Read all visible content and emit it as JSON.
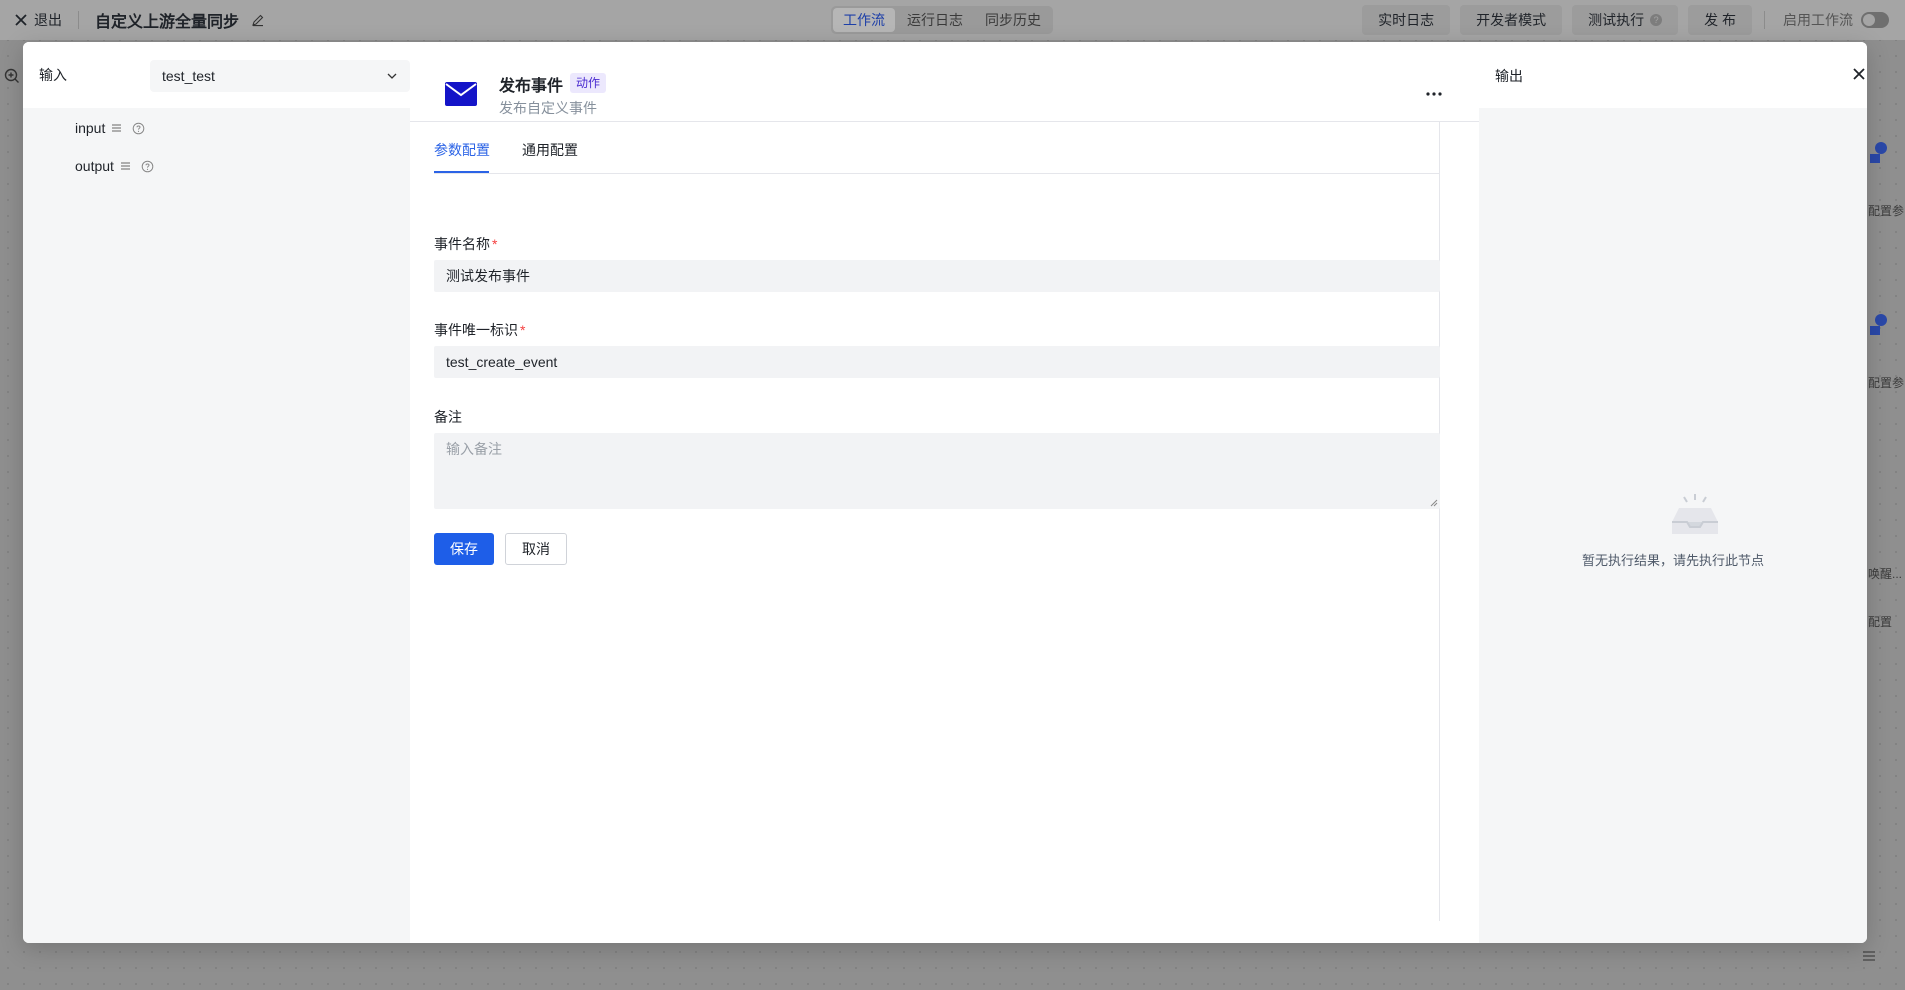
{
  "topbar": {
    "exit_label": "退出",
    "workflow_title": "自定义上游全量同步",
    "segments": [
      "工作流",
      "运行日志",
      "同步历史"
    ],
    "active_segment": "工作流",
    "buttons": {
      "realtime_log": "实时日志",
      "developer_mode": "开发者模式",
      "test_run": "测试执行",
      "publish": "发 布"
    },
    "enable_label": "启用工作流"
  },
  "background": {
    "frag1": "配置参",
    "frag2": "配置参",
    "frag3": "唤醒...",
    "frag4": "配置"
  },
  "input_panel": {
    "title": "输入",
    "selected_value": "test_test",
    "tree": [
      {
        "label": "input"
      },
      {
        "label": "output"
      }
    ]
  },
  "node": {
    "title": "发布事件",
    "tag": "动作",
    "subtitle": "发布自定义事件",
    "tabs": [
      "参数配置",
      "通用配置"
    ],
    "active_tab": "参数配置",
    "fields": {
      "event_name_label": "事件名称",
      "event_name_value": "测试发布事件",
      "event_id_label": "事件唯一标识",
      "event_id_value": "test_create_event",
      "remark_label": "备注",
      "remark_placeholder": "输入备注",
      "required_mark": "*"
    },
    "save_label": "保存",
    "cancel_label": "取消"
  },
  "output_panel": {
    "title": "输出",
    "empty_text": "暂无执行结果，请先执行此节点"
  },
  "colors": {
    "accent": "#1e5ee8",
    "tab_active": "#2b63e6",
    "tag_text": "#4a2bd0",
    "tag_bg": "#ece8fd",
    "required": "#f53f3f"
  }
}
